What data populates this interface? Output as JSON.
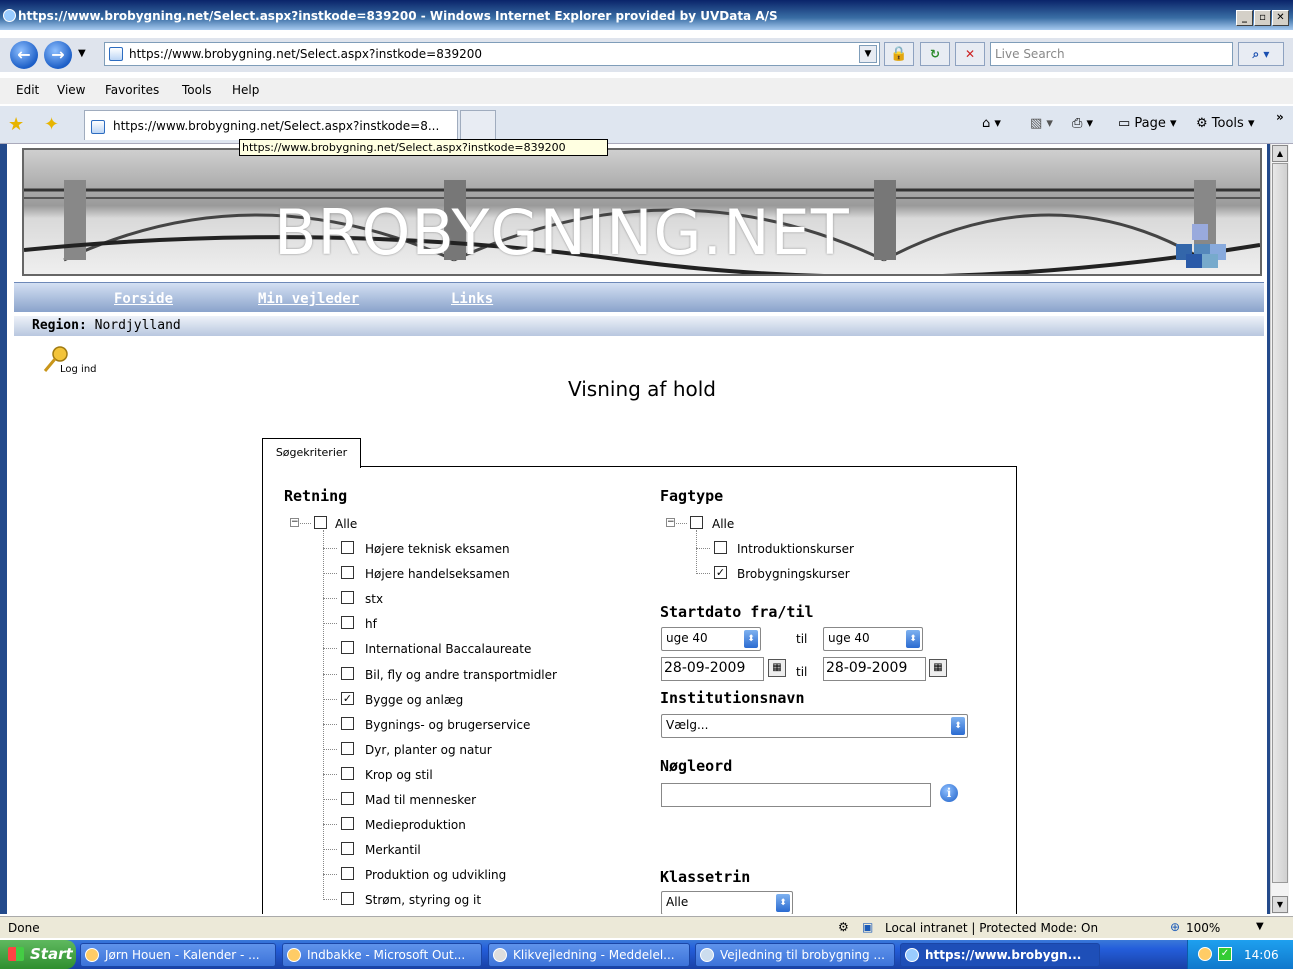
{
  "window": {
    "title": "https://www.brobygning.net/Select.aspx?instkode=839200 - Windows Internet Explorer provided by UVData A/S",
    "minimize": "_",
    "maximize": "▫",
    "close": "✕"
  },
  "address": {
    "url": "https://www.brobygning.net/Select.aspx?instkode=839200",
    "search_placeholder": "Live Search"
  },
  "menu": [
    "Edit",
    "View",
    "Favorites",
    "Tools",
    "Help"
  ],
  "tab": {
    "title": "https://www.brobygning.net/Select.aspx?instkode=8...",
    "tooltip": "https://www.brobygning.net/Select.aspx?instkode=839200"
  },
  "command_bar": {
    "page": "Page",
    "tools": "Tools"
  },
  "site": {
    "logo": "BROBYGNING.NET",
    "nav": [
      "Forside",
      "Min vejleder",
      "Links"
    ],
    "region_label": "Region:",
    "region_value": "Nordjylland",
    "login": "Log ind",
    "heading": "Visning af hold"
  },
  "form": {
    "tab": "Søgekriterier",
    "retning": {
      "title": "Retning",
      "all": "Alle",
      "items": [
        {
          "label": "Højere teknisk eksamen",
          "checked": false
        },
        {
          "label": "Højere handelseksamen",
          "checked": false
        },
        {
          "label": "stx",
          "checked": false
        },
        {
          "label": "hf",
          "checked": false
        },
        {
          "label": "International Baccalaureate",
          "checked": false
        },
        {
          "label": "Bil, fly og andre transportmidler",
          "checked": false
        },
        {
          "label": "Bygge og anlæg",
          "checked": true
        },
        {
          "label": "Bygnings- og brugerservice",
          "checked": false
        },
        {
          "label": "Dyr, planter og natur",
          "checked": false
        },
        {
          "label": "Krop og stil",
          "checked": false
        },
        {
          "label": "Mad til mennesker",
          "checked": false
        },
        {
          "label": "Medieproduktion",
          "checked": false
        },
        {
          "label": "Merkantil",
          "checked": false
        },
        {
          "label": "Produktion og udvikling",
          "checked": false
        },
        {
          "label": "Strøm, styring og it",
          "checked": false
        }
      ]
    },
    "fagtype": {
      "title": "Fagtype",
      "all": "Alle",
      "items": [
        {
          "label": "Introduktionskurser",
          "checked": false
        },
        {
          "label": "Brobygningskurser",
          "checked": true
        }
      ]
    },
    "startdato": {
      "title": "Startdato fra/til",
      "week_from": "uge 40",
      "week_to": "uge 40",
      "til": "til",
      "date_from": "28-09-2009",
      "date_to": "28-09-2009"
    },
    "institution": {
      "title": "Institutionsnavn",
      "value": "Vælg..."
    },
    "keyword": {
      "title": "Nøgleord",
      "value": ""
    },
    "klassetrin": {
      "title": "Klassetrin",
      "value": "Alle"
    }
  },
  "status": {
    "text": "Done",
    "zone": "Local intranet | Protected Mode: On",
    "zoom": "100%"
  },
  "taskbar": {
    "start": "Start",
    "tasks": [
      "Jørn Houen - Kalender - ...",
      "Indbakke - Microsoft Out...",
      "Klikvejledning - Meddelel...",
      "Vejledning til brobygning ...",
      "https://www.brobygn..."
    ],
    "clock": "14:06"
  }
}
